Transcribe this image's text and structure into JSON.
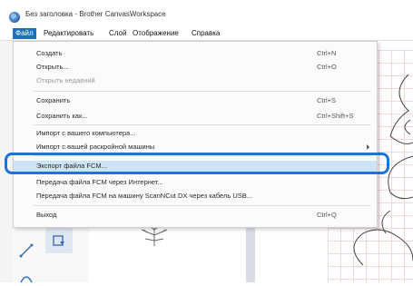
{
  "window": {
    "title": "Без заголовка - Brother CanvasWorkspace"
  },
  "menubar": {
    "items": [
      "Файл",
      "Редактировать",
      "Слой",
      "Отображение",
      "Справка"
    ]
  },
  "file_menu": {
    "items": [
      {
        "label": "Создать",
        "shortcut": "Ctrl+N"
      },
      {
        "label": "Открыть...",
        "shortcut": "Ctrl+O"
      },
      {
        "label": "Открыть недавний",
        "shortcut": ""
      },
      {
        "label": "Сохранить",
        "shortcut": "Ctrl+S"
      },
      {
        "label": "Сохранить как...",
        "shortcut": "Ctrl+Shift+S"
      },
      {
        "label": "Импорт с вашего компьютера...",
        "shortcut": ""
      },
      {
        "label": "Импорт с вашей раскройной машины",
        "shortcut": ""
      },
      {
        "label": "Экспорт файла FCM...",
        "shortcut": ""
      },
      {
        "label": "Передача файла FCM через Интернет...",
        "shortcut": ""
      },
      {
        "label": "Передача файла FCM на машину ScanNCut DX через кабель USB...",
        "shortcut": ""
      },
      {
        "label": "Выход",
        "shortcut": "Ctrl+Q"
      }
    ]
  },
  "icons": [
    "app-logo-icon",
    "submenu-arrow-icon",
    "line-tool-icon",
    "shape-tool-icon",
    "flower-motif-icon"
  ]
}
